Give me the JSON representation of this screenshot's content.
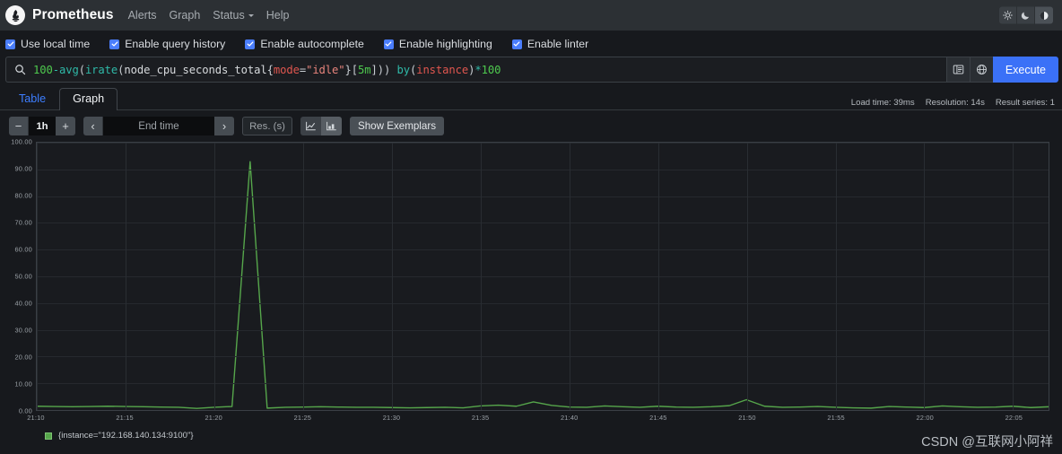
{
  "navbar": {
    "logo_icon": "prometheus-torch-icon",
    "brand": "Prometheus",
    "links": [
      {
        "label": "Alerts",
        "name": "nav-link-alerts",
        "caret": false
      },
      {
        "label": "Graph",
        "name": "nav-link-graph",
        "caret": false
      },
      {
        "label": "Status",
        "name": "nav-link-status",
        "caret": true
      },
      {
        "label": "Help",
        "name": "nav-link-help",
        "caret": false
      }
    ],
    "theme_buttons": [
      {
        "icon": "sun-icon",
        "name": "theme-light-button",
        "selected": false
      },
      {
        "icon": "moon-icon",
        "name": "theme-dark-button",
        "selected": false
      },
      {
        "icon": "contrast-icon",
        "name": "theme-auto-button",
        "selected": true
      }
    ]
  },
  "options": [
    {
      "label": "Use local time",
      "checked": true,
      "name": "checkbox-use-local-time"
    },
    {
      "label": "Enable query history",
      "checked": true,
      "name": "checkbox-enable-query-history"
    },
    {
      "label": "Enable autocomplete",
      "checked": true,
      "name": "checkbox-enable-autocomplete"
    },
    {
      "label": "Enable highlighting",
      "checked": true,
      "name": "checkbox-enable-highlighting"
    },
    {
      "label": "Enable linter",
      "checked": true,
      "name": "checkbox-enable-linter"
    }
  ],
  "query": {
    "search_icon": "search-icon",
    "expression": "100-avg(irate(node_cpu_seconds_total{mode=\"idle\"}[5m])) by(instance)*100",
    "tokens": [
      {
        "t": "100",
        "c": "tk-num"
      },
      {
        "t": "-",
        "c": "tk-op"
      },
      {
        "t": "avg",
        "c": "tk-func"
      },
      {
        "t": "(",
        "c": "tk-punc"
      },
      {
        "t": "irate",
        "c": "tk-func"
      },
      {
        "t": "(",
        "c": "tk-punc"
      },
      {
        "t": "node_cpu_seconds_total",
        "c": "tk-met"
      },
      {
        "t": "{",
        "c": "tk-punc"
      },
      {
        "t": "mode",
        "c": "tk-lbl"
      },
      {
        "t": "=",
        "c": "tk-punc"
      },
      {
        "t": "\"idle\"",
        "c": "tk-str"
      },
      {
        "t": "}",
        "c": "tk-punc"
      },
      {
        "t": "[",
        "c": "tk-punc"
      },
      {
        "t": "5m",
        "c": "tk-dur"
      },
      {
        "t": "]",
        "c": "tk-punc"
      },
      {
        "t": "))",
        "c": "tk-punc"
      },
      {
        "t": " by",
        "c": "tk-op"
      },
      {
        "t": "(",
        "c": "tk-punc"
      },
      {
        "t": "instance",
        "c": "tk-lbl"
      },
      {
        "t": ")",
        "c": "tk-punc"
      },
      {
        "t": "*",
        "c": "tk-op"
      },
      {
        "t": "100",
        "c": "tk-num"
      }
    ],
    "metrics_explorer_icon": "metrics-explorer-icon",
    "globe_icon": "globe-icon",
    "execute_label": "Execute"
  },
  "tabs": [
    {
      "label": "Table",
      "active": false,
      "name": "tab-table"
    },
    {
      "label": "Graph",
      "active": true,
      "name": "tab-graph"
    }
  ],
  "stats": {
    "load_time": "Load time: 39ms",
    "resolution": "Resolution: 14s",
    "result_series": "Result series: 1"
  },
  "controls": {
    "decrease_range": "−",
    "range_value": "1h",
    "increase_range": "+",
    "prev_arrow": "‹",
    "end_time_placeholder": "End time",
    "next_arrow": "›",
    "resolution_placeholder": "Res. (s)",
    "line_chart_icon": "line-chart-icon",
    "stacked_chart_icon": "stacked-chart-icon",
    "show_exemplars_label": "Show Exemplars"
  },
  "chart_data": {
    "type": "line",
    "title": "",
    "xlabel": "",
    "ylabel": "",
    "ylim": [
      0,
      100
    ],
    "y_ticks": [
      "0.00",
      "10.00",
      "20.00",
      "30.00",
      "40.00",
      "50.00",
      "60.00",
      "70.00",
      "80.00",
      "90.00",
      "100.00"
    ],
    "y_tick_values": [
      0,
      10,
      20,
      30,
      40,
      50,
      60,
      70,
      80,
      90,
      100
    ],
    "x_ticks": [
      "21:10",
      "21:15",
      "21:20",
      "21:25",
      "21:30",
      "21:35",
      "21:40",
      "21:45",
      "21:50",
      "21:55",
      "22:00",
      "22:05"
    ],
    "grid": true,
    "legend_position": "bottom",
    "series": [
      {
        "name": "{instance=\"192.168.140.134:9100\"}",
        "color": "#56a64b",
        "x": [
          21.117,
          21.133,
          21.15,
          21.167,
          21.183,
          21.2,
          21.217,
          21.233,
          21.25,
          21.267,
          21.283,
          21.3,
          21.317,
          21.333,
          21.35,
          21.367,
          21.383,
          21.4,
          21.417,
          21.433,
          21.45,
          21.467,
          21.483,
          21.5,
          21.517,
          21.533,
          21.55,
          21.567,
          21.583,
          21.6,
          21.617,
          21.633,
          21.65,
          21.667,
          21.683,
          21.7,
          21.717,
          21.733,
          21.75,
          21.767,
          21.783,
          21.8,
          21.817,
          21.833,
          21.85,
          21.867,
          21.883,
          21.9,
          21.917,
          21.933,
          21.95,
          21.967,
          21.983,
          22.0,
          22.017,
          22.033,
          22.05,
          22.067,
          22.083,
          22.1,
          22.117
        ],
        "values": [
          2.2,
          2.6,
          2.9,
          3.0,
          2.9,
          2.8,
          2.9,
          3.0,
          2.9,
          2.8,
          2.7,
          2.6,
          2.2,
          2.6,
          2.9,
          93.0,
          2.3,
          2.6,
          2.7,
          2.8,
          2.7,
          2.6,
          2.6,
          2.5,
          2.4,
          2.5,
          2.6,
          2.4,
          3.1,
          3.4,
          3.0,
          4.6,
          3.3,
          2.7,
          2.6,
          3.1,
          2.8,
          2.6,
          3.0,
          2.7,
          2.6,
          2.8,
          3.2,
          5.4,
          3.0,
          2.6,
          2.7,
          2.9,
          2.6,
          2.4,
          2.3,
          2.9,
          2.7,
          2.5,
          3.1,
          2.8,
          2.6,
          2.7,
          3.0,
          2.5,
          2.8
        ],
        "peak_value": 93.0,
        "peak_time": "21:22",
        "baseline_range": [
          2.2,
          5.4
        ]
      }
    ]
  },
  "legend": {
    "swatch_color": "#56a64b",
    "label": "{instance=\"192.168.140.134:9100\"}"
  },
  "watermark": {
    "text": "CSDN @互联网小阿祥"
  }
}
